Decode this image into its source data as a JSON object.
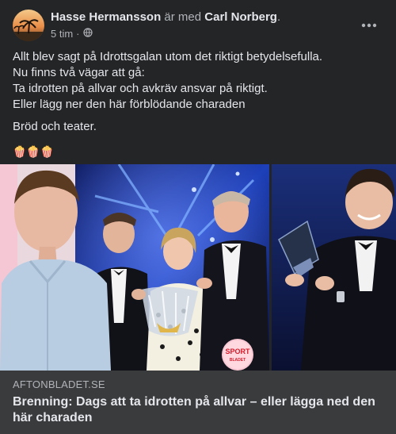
{
  "post": {
    "author": "Hasse Hermansson",
    "with_text": "är med",
    "tagged": "Carl Norberg",
    "tag_end": ".",
    "time": "5 tim",
    "dot": "·",
    "audience_icon": "globe-icon",
    "menu_icon": "more-horizontal-icon",
    "lines": [
      "Allt blev sagt på Idrottsgalan utom det riktigt betydelsefulla.",
      "Nu finns två vägar att gå:",
      "Ta idrotten på allvar och avkräv ansvar på riktigt.",
      "Eller lägg ner den här förblödande charaden"
    ],
    "line2": "Bröd och teater.",
    "emojis": "🍿🍿🍿"
  },
  "link": {
    "domain": "AFTONBLADET.SE",
    "headline": "Brenning: Dags att ta idrotten på allvar – eller lägga ned den här charaden",
    "badge_top": "SPORT",
    "badge_bottom": "BLADET"
  },
  "colors": {
    "background": "#242526",
    "card": "#3a3b3c",
    "text": "#e4e6eb",
    "muted": "#b0b3b8"
  }
}
